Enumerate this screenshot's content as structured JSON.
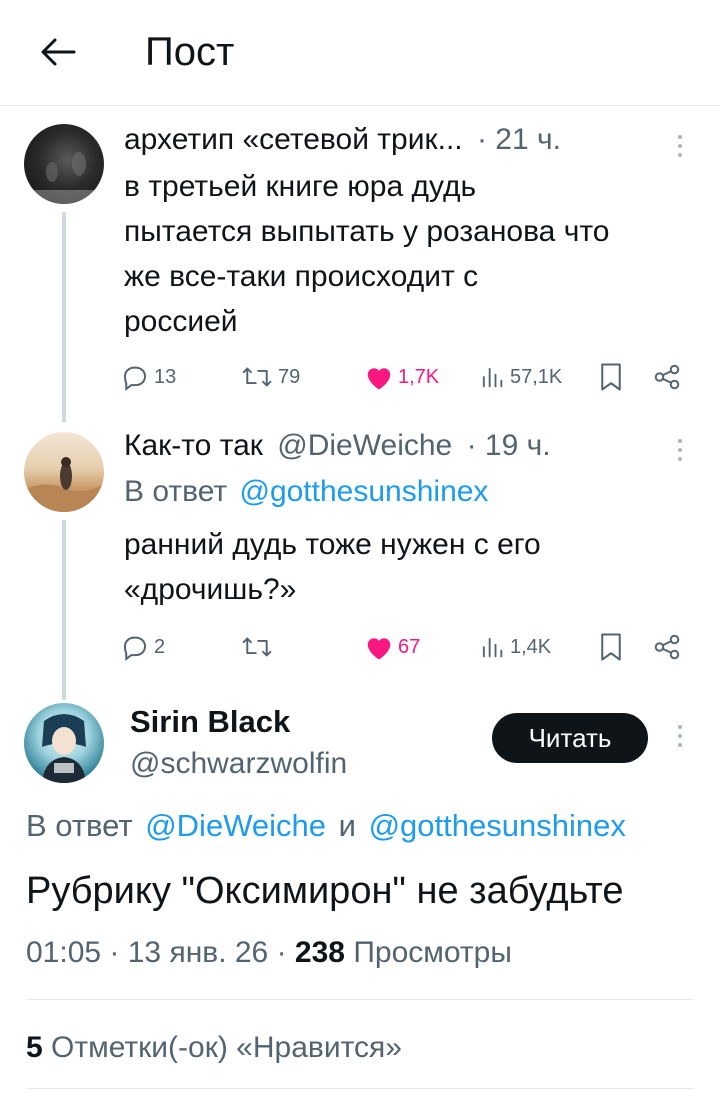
{
  "header": {
    "title": "Пост"
  },
  "thread": [
    {
      "author_name": "архетип «сетевой трик...",
      "time": "· 21 ч.",
      "text_lines": [
        "в третьей книге юра дудь",
        "пытается выпытать у розанова что",
        "же все-таки происходит с",
        "россией"
      ],
      "stats": {
        "replies": "13",
        "reposts": "79",
        "likes": "1,7K",
        "views": "57,1K"
      }
    },
    {
      "author_name": "Как-то так",
      "handle": "@DieWeiche",
      "time": "· 19 ч.",
      "reply_prefix": "В ответ",
      "reply_to": "@gotthesunshinex",
      "text_lines": [
        "ранний дудь тоже нужен с его",
        "«дрочишь?»"
      ],
      "stats": {
        "replies": "2",
        "reposts": "",
        "likes": "67",
        "views": "1,4K"
      }
    }
  ],
  "main_post": {
    "author_name": "Sirin Black",
    "handle": "@schwarzwolfin",
    "follow_label": "Читать",
    "reply_prefix": "В ответ",
    "reply_to_1": "@DieWeiche",
    "reply_and": "и",
    "reply_to_2": "@gotthesunshinex",
    "text": "Рубрику \"Оксимирон\" не забудьте",
    "time": "01:05",
    "date": "13 янв. 26",
    "views_count": "238",
    "views_label": "Просмотры",
    "likes_count": "5",
    "likes_label": "Отметки(-ок) «Нравится»"
  },
  "colors": {
    "accent": "#1d9bf0",
    "like": "#f91880",
    "text": "#0f1419",
    "muted": "#536471"
  }
}
